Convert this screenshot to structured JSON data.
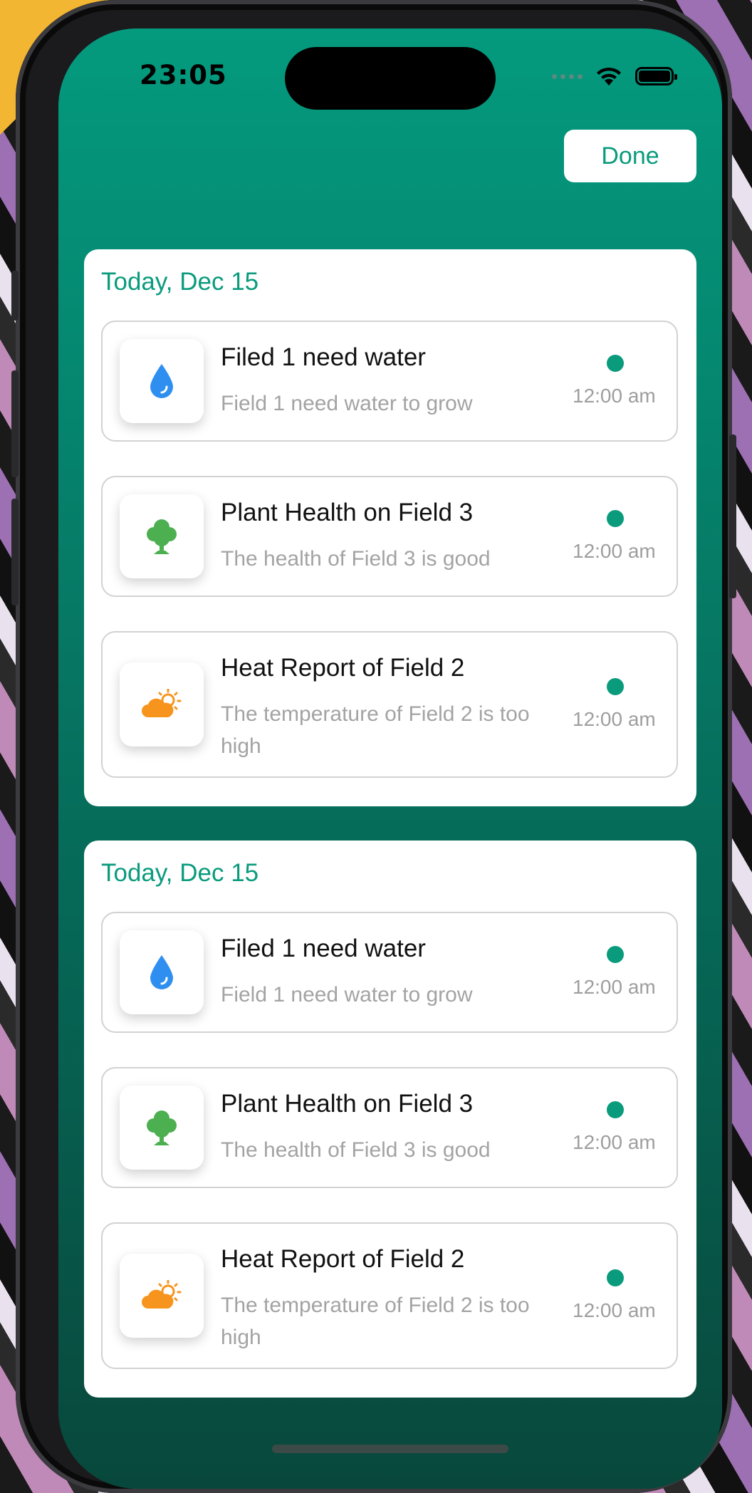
{
  "status_bar": {
    "time": "23:05"
  },
  "header": {
    "done_label": "Done"
  },
  "colors": {
    "accent": "#0a9b7d",
    "water": "#2f8ff0",
    "tree": "#4caf50",
    "weather": "#f7941d"
  },
  "sections": [
    {
      "title": "Today, Dec 15",
      "items": [
        {
          "icon": "water-drop-icon",
          "title": "Filed 1 need water",
          "subtitle": "Field 1 need water to grow",
          "time": "12:00 am",
          "unread": true
        },
        {
          "icon": "tree-icon",
          "title": "Plant Health on Field 3",
          "subtitle": "The health of Field 3 is good",
          "time": "12:00 am",
          "unread": true
        },
        {
          "icon": "partly-sunny-icon",
          "title": "Heat Report of Field 2",
          "subtitle": "The temperature of Field 2 is too high",
          "time": "12:00 am",
          "unread": true
        }
      ]
    },
    {
      "title": "Today, Dec 15",
      "items": [
        {
          "icon": "water-drop-icon",
          "title": "Filed 1 need water",
          "subtitle": "Field 1 need water to grow",
          "time": "12:00 am",
          "unread": true
        },
        {
          "icon": "tree-icon",
          "title": "Plant Health on Field 3",
          "subtitle": "The health of Field 3 is good",
          "time": "12:00 am",
          "unread": true
        },
        {
          "icon": "partly-sunny-icon",
          "title": "Heat Report of Field 2",
          "subtitle": "The temperature of Field 2 is too high",
          "time": "12:00 am",
          "unread": true
        }
      ]
    }
  ]
}
